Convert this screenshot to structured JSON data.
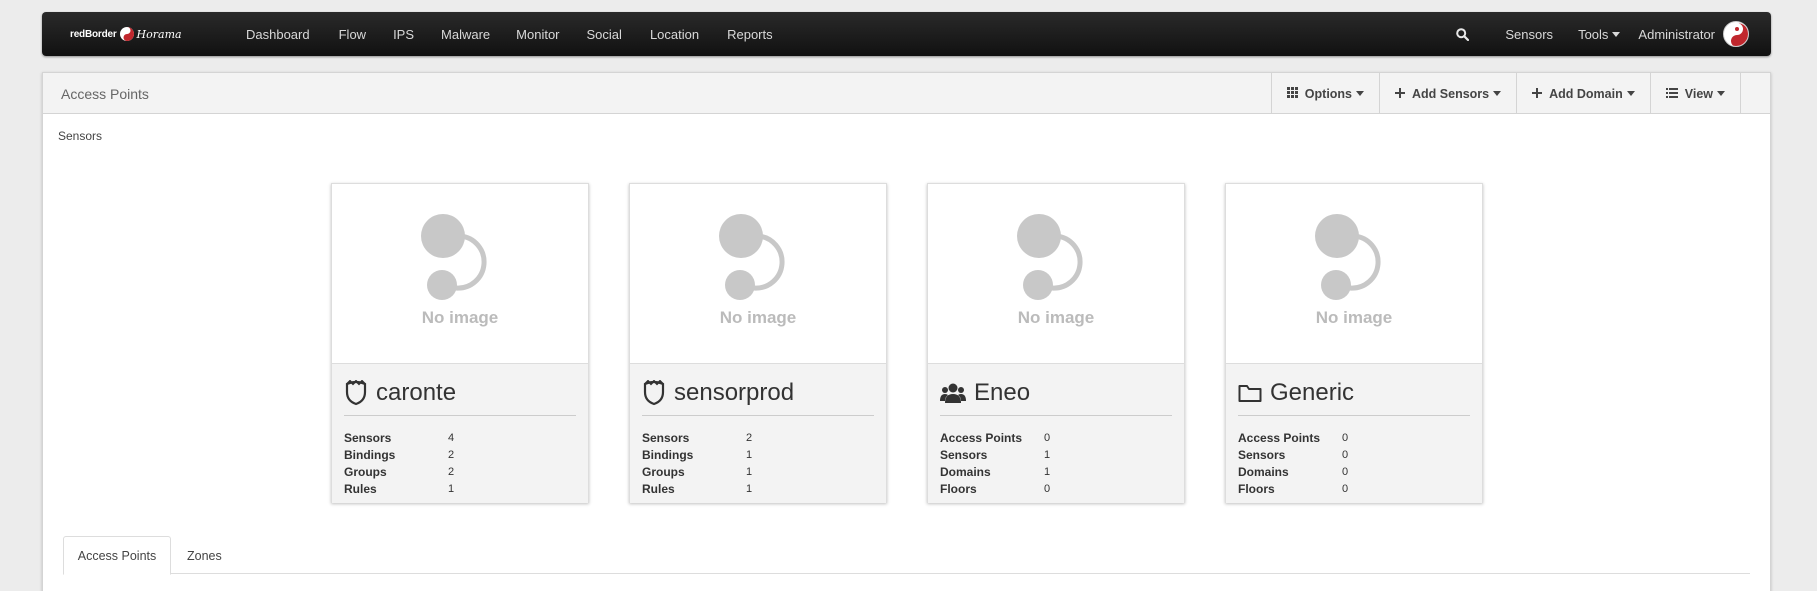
{
  "brand": {
    "name": "redBorder",
    "sub": "Horama"
  },
  "nav": {
    "items": [
      "Dashboard",
      "Flow",
      "IPS",
      "Malware",
      "Monitor",
      "Social",
      "Location",
      "Reports"
    ],
    "right": {
      "sensors": "Sensors",
      "tools": "Tools",
      "user": "Administrator"
    }
  },
  "panel": {
    "title": "Access Points",
    "toolbar": {
      "options": "Options",
      "add_sensors": "Add Sensors",
      "add_domain": "Add Domain",
      "view": "View"
    },
    "breadcrumb": "Sensors"
  },
  "cards": [
    {
      "name": "caronte",
      "icon": "shield-icon",
      "noimage": "No image",
      "stats": [
        {
          "k": "Sensors",
          "v": "4"
        },
        {
          "k": "Bindings",
          "v": "2"
        },
        {
          "k": "Groups",
          "v": "2"
        },
        {
          "k": "Rules",
          "v": "1"
        }
      ]
    },
    {
      "name": "sensorprod",
      "icon": "shield-icon",
      "noimage": "No image",
      "stats": [
        {
          "k": "Sensors",
          "v": "2"
        },
        {
          "k": "Bindings",
          "v": "1"
        },
        {
          "k": "Groups",
          "v": "1"
        },
        {
          "k": "Rules",
          "v": "1"
        }
      ]
    },
    {
      "name": "Eneo",
      "icon": "users-icon",
      "noimage": "No image",
      "stats": [
        {
          "k": "Access Points",
          "v": "0"
        },
        {
          "k": "Sensors",
          "v": "1"
        },
        {
          "k": "Domains",
          "v": "1"
        },
        {
          "k": "Floors",
          "v": "0"
        }
      ]
    },
    {
      "name": "Generic",
      "icon": "folder-icon",
      "noimage": "No image",
      "stats": [
        {
          "k": "Access Points",
          "v": "0"
        },
        {
          "k": "Sensors",
          "v": "0"
        },
        {
          "k": "Domains",
          "v": "0"
        },
        {
          "k": "Floors",
          "v": "0"
        }
      ]
    }
  ],
  "tabs": [
    "Access Points",
    "Zones"
  ],
  "colors": {
    "navbar": "#1a1a1a",
    "panel_head": "#f3f3f3",
    "brand_accent": "#c0272d"
  }
}
